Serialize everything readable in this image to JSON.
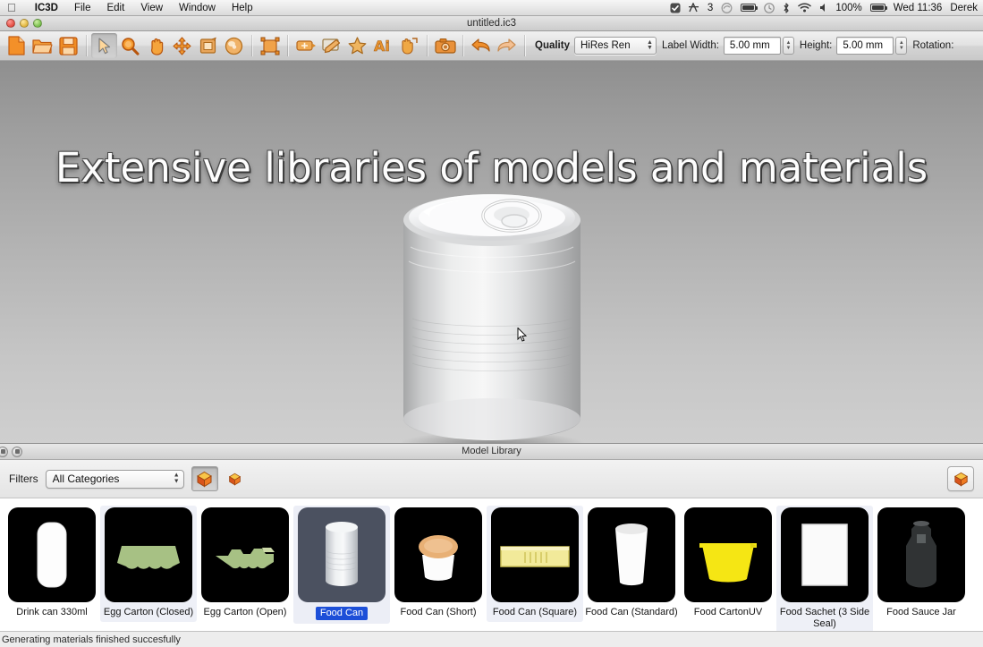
{
  "menubar": {
    "apple_icon": "apple-logo-icon",
    "items": [
      "IC3D",
      "File",
      "Edit",
      "View",
      "Window",
      "Help"
    ],
    "right_icons": [
      "checkmark-badge-icon",
      "signal-bars-icon",
      "dropbox-icon",
      "battery-icon",
      "clock-icon",
      "bluetooth-icon",
      "wifi-icon",
      "volume-icon"
    ],
    "signal_count": "3",
    "battery_percent": "100%",
    "clock": "Wed 11:36",
    "user": "Derek"
  },
  "window": {
    "title": "untitled.ic3",
    "traffic_lights": [
      "close-button",
      "minimize-button",
      "zoom-button"
    ]
  },
  "toolbar": {
    "icons": [
      {
        "name": "new-document-icon",
        "label": "New"
      },
      {
        "name": "open-folder-icon",
        "label": "Open"
      },
      {
        "name": "save-disk-icon",
        "label": "Save"
      },
      {
        "name": "select-arrow-icon",
        "label": "Select"
      },
      {
        "name": "zoom-magnifier-icon",
        "label": "Zoom"
      },
      {
        "name": "pan-hand-icon",
        "label": "Pan"
      },
      {
        "name": "move-arrows-icon",
        "label": "Move"
      },
      {
        "name": "label-placement-icon",
        "label": "Label"
      },
      {
        "name": "render-sphere-icon",
        "label": "Render"
      },
      {
        "name": "fit-to-view-icon",
        "label": "Fit to View"
      },
      {
        "name": "add-artwork-icon",
        "label": "Add Artwork"
      },
      {
        "name": "edit-artwork-icon",
        "label": "Edit Artwork"
      },
      {
        "name": "favourites-star-icon",
        "label": "Favourites"
      },
      {
        "name": "illustrator-ai-icon",
        "label": "Illustrator"
      },
      {
        "name": "export-icon",
        "label": "Export"
      },
      {
        "name": "camera-snapshot-icon",
        "label": "Snapshot"
      },
      {
        "name": "undo-arrow-icon",
        "label": "Undo"
      },
      {
        "name": "redo-arrow-icon",
        "label": "Redo"
      }
    ],
    "quality_label": "Quality",
    "quality_value": "HiRes Ren",
    "label_width_label": "Label Width:",
    "label_width_value": "5.00 mm",
    "height_label": "Height:",
    "height_value": "5.00 mm",
    "rotation_label": "Rotation:"
  },
  "viewport": {
    "overlay_text": "Extensive libraries of models and materials",
    "model_name": "Food Can",
    "cursor": "arrow-cursor"
  },
  "panel": {
    "title": "Model Library",
    "filters_label": "Filters",
    "filter_value": "All Categories",
    "view_buttons": [
      "model-view-button",
      "material-view-button"
    ],
    "right_button": "add-model-button"
  },
  "library": {
    "items": [
      {
        "label": "Drink can 330ml",
        "shape": "can-white",
        "selected": false
      },
      {
        "label": "Egg Carton (Closed)",
        "shape": "egg-closed",
        "selected": false
      },
      {
        "label": "Egg Carton (Open)",
        "shape": "egg-open",
        "selected": false
      },
      {
        "label": "Food Can",
        "shape": "can-metal",
        "selected": true
      },
      {
        "label": "Food Can (Short)",
        "shape": "can-short",
        "selected": false
      },
      {
        "label": "Food Can (Square)",
        "shape": "can-square",
        "selected": false
      },
      {
        "label": "Food Can (Standard)",
        "shape": "cup-white",
        "selected": false
      },
      {
        "label": "Food CartonUV",
        "shape": "tray-yellow",
        "selected": false
      },
      {
        "label": "Food Sachet (3 Side Seal)",
        "shape": "sachet-white",
        "selected": false
      },
      {
        "label": "Food Sauce Jar",
        "shape": "jar-glass",
        "selected": false
      }
    ]
  },
  "statusbar": {
    "message": "Generating materials finished succesfully"
  },
  "colors": {
    "selection_blue": "#1d4fd8",
    "toolbar_orange": "#e8861f",
    "thumb_black": "#000000"
  }
}
